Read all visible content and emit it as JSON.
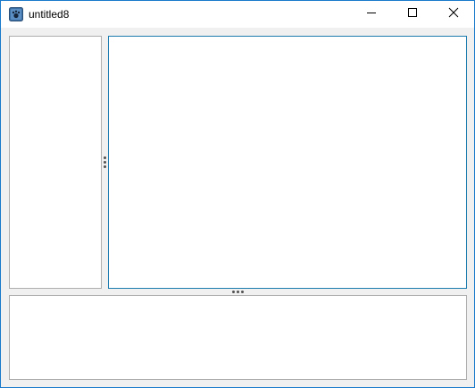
{
  "window": {
    "title": "untitled8",
    "accent_color": "#1979ca",
    "app_icon": "app-icon",
    "controls": {
      "minimize_icon": "minimize-icon",
      "maximize_icon": "maximize-icon",
      "close_icon": "close-icon"
    }
  },
  "layout": {
    "panes": [
      "left-pane",
      "main-pane",
      "bottom-pane"
    ],
    "focused_pane": "main-pane",
    "focus_color": "#1b7bae",
    "pane_border_color": "#adadad",
    "splitters": [
      "vertical-splitter",
      "horizontal-splitter"
    ]
  }
}
